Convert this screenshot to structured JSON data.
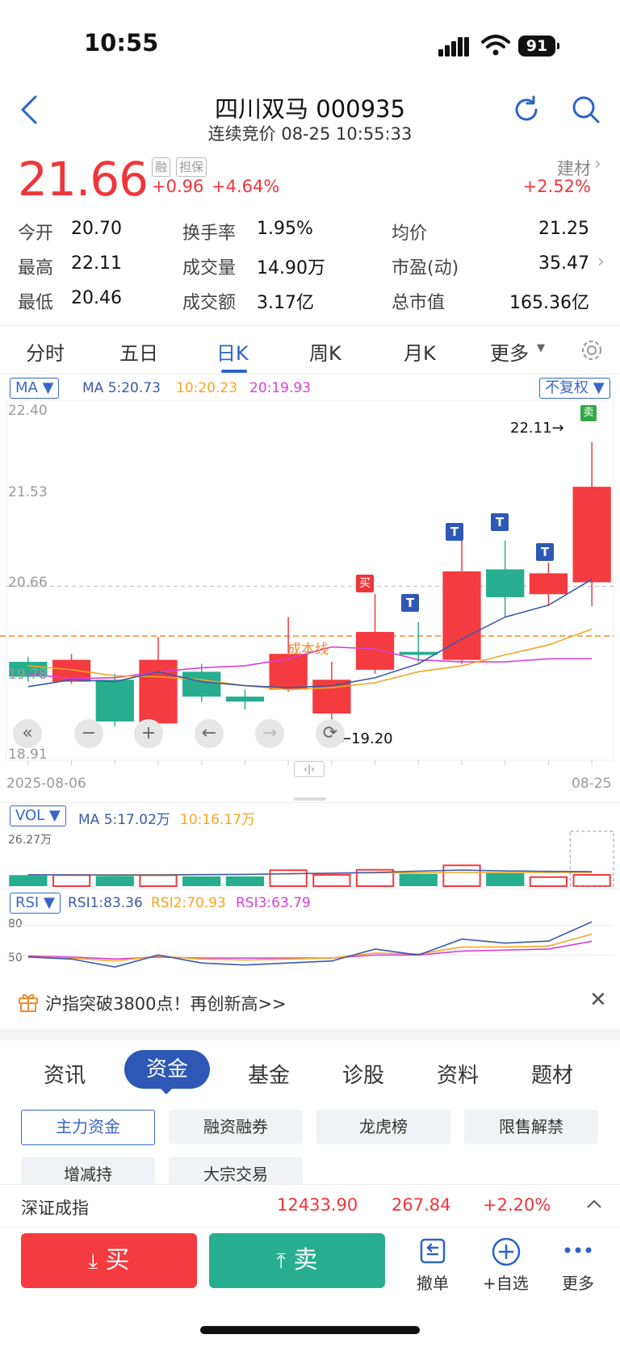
{
  "status_bar": {
    "time": "10:55",
    "battery": "91"
  },
  "header": {
    "title": "四川双马 000935",
    "subtitle": "连续竞价 08-25 10:55:33"
  },
  "quote": {
    "price": "21.66",
    "tags": [
      "融",
      "担保"
    ],
    "change": "+0.96",
    "change_pct": "+4.64%",
    "sector_name": "建材",
    "sector_pct": "+2.52%",
    "stats": [
      {
        "label": "今开",
        "value": "20.70",
        "color": "#111111"
      },
      {
        "label": "最高",
        "value": "22.11",
        "color": "#f0353a"
      },
      {
        "label": "最低",
        "value": "20.46",
        "color": "#20a98a"
      },
      {
        "label": "换手率",
        "value": "1.95%",
        "color": "#111111"
      },
      {
        "label": "成交量",
        "value": "14.90万",
        "color": "#111111"
      },
      {
        "label": "成交额",
        "value": "3.17亿",
        "color": "#111111"
      },
      {
        "label": "均价",
        "value": "21.25",
        "color": "#f0353a"
      },
      {
        "label": "市盈(动)",
        "value": "35.47",
        "color": "#111111"
      },
      {
        "label": "总市值",
        "value": "165.36亿",
        "color": "#111111"
      }
    ]
  },
  "chart_tabs": [
    {
      "label": "分时"
    },
    {
      "label": "五日"
    },
    {
      "label": "日K"
    },
    {
      "label": "周K"
    },
    {
      "label": "月K"
    },
    {
      "label": "更多"
    }
  ],
  "kline": {
    "indicator": "MA",
    "ma5": "MA 5:20.73",
    "ma10": "10:20.23",
    "ma20": "20:19.93",
    "adjust": "不复权",
    "y_ticks": [
      "22.40",
      "21.53",
      "20.66",
      "19.78",
      "18.91"
    ],
    "cost_line_label": "成本线",
    "high_marker": "22.11→",
    "low_marker": "←19.20",
    "date_start": "2025-08-06",
    "date_end": "08-25",
    "buy_mark": "买",
    "sell_mark": "卖",
    "t_mark": "T"
  },
  "chart_data": {
    "type": "candlestick",
    "candles": [
      {
        "o": 19.9,
        "c": 19.75,
        "h": 19.95,
        "l": 19.7
      },
      {
        "o": 19.7,
        "c": 19.92,
        "h": 19.98,
        "l": 19.68
      },
      {
        "o": 19.72,
        "c": 19.3,
        "h": 19.78,
        "l": 19.25
      },
      {
        "o": 19.28,
        "c": 19.92,
        "h": 20.15,
        "l": 19.25
      },
      {
        "o": 19.8,
        "c": 19.55,
        "h": 19.88,
        "l": 19.5
      },
      {
        "o": 19.55,
        "c": 19.5,
        "h": 19.62,
        "l": 19.42
      },
      {
        "o": 19.62,
        "c": 19.98,
        "h": 20.35,
        "l": 19.6
      },
      {
        "o": 19.38,
        "c": 19.72,
        "h": 19.9,
        "l": 19.2
      },
      {
        "o": 19.82,
        "c": 20.2,
        "h": 20.58,
        "l": 19.78
      },
      {
        "o": 20.0,
        "c": 19.97,
        "h": 20.3,
        "l": 19.9
      },
      {
        "o": 19.92,
        "c": 20.81,
        "h": 21.2,
        "l": 19.88
      },
      {
        "o": 20.83,
        "c": 20.55,
        "h": 21.12,
        "l": 20.35
      },
      {
        "o": 20.58,
        "c": 20.79,
        "h": 20.9,
        "l": 20.46
      },
      {
        "o": 20.7,
        "c": 21.66,
        "h": 22.11,
        "l": 20.46
      }
    ],
    "ma5": [
      19.65,
      19.72,
      19.7,
      19.8,
      19.7,
      19.66,
      19.64,
      19.66,
      19.74,
      19.88,
      20.13,
      20.35,
      20.47,
      20.73
    ],
    "ma10": [
      19.86,
      19.82,
      19.76,
      19.75,
      19.72,
      19.66,
      19.62,
      19.64,
      19.69,
      19.8,
      19.86,
      19.97,
      20.07,
      20.23
    ],
    "ma20": [
      19.78,
      19.73,
      19.74,
      19.8,
      19.84,
      19.86,
      19.93,
      20.05,
      20.03,
      19.92,
      19.9,
      19.9,
      19.93,
      19.93
    ],
    "cost_line": 20.16,
    "ylim": [
      18.91,
      22.4
    ],
    "volume": {
      "label": "VOL",
      "ma_text": "MA 5:17.02万",
      "ma10_text": "10:16.17万",
      "max_label": "26.27万",
      "values": [
        5,
        5,
        4.6,
        5,
        4.4,
        4.4,
        7.2,
        5.1,
        7.4,
        5.6,
        9.4,
        5.9,
        4.1,
        5.1
      ],
      "ylim": [
        0,
        26.27
      ],
      "ma5": [
        5.2,
        5.1,
        5.0,
        5.0,
        5.2,
        5.3,
        5.6,
        5.9,
        6.2,
        6.8,
        7.3,
        6.9,
        6.7,
        6.6
      ],
      "ma10": [
        5.0,
        5.1,
        5.1,
        5.2,
        5.3,
        5.4,
        5.6,
        5.8,
        6.0,
        6.1,
        6.2,
        6.2,
        6.2,
        6.2
      ]
    },
    "rsi": {
      "label": "RSI",
      "rsi1_text": "RSI1:83.36",
      "rsi2_text": "RSI2:70.93",
      "rsi3_text": "RSI3:63.79",
      "ticks": [
        "80",
        "50"
      ],
      "rsi1": [
        48,
        46,
        38,
        50,
        42,
        40,
        42,
        44,
        56,
        50,
        66,
        62,
        64,
        83.36
      ],
      "rsi2": [
        48,
        47,
        44,
        49,
        46,
        45,
        46,
        47,
        52,
        51,
        58,
        58,
        59,
        70.93
      ],
      "rsi3": [
        49,
        48,
        46,
        48,
        47,
        47,
        47,
        47,
        50,
        50,
        54,
        55,
        56,
        63.79
      ],
      "ylim": [
        30,
        90
      ]
    }
  },
  "banner": {
    "text": "沪指突破3800点！再创新高>>"
  },
  "section_tabs": [
    "资讯",
    "资金",
    "基金",
    "诊股",
    "资料",
    "题材"
  ],
  "sub_tabs": [
    "主力资金",
    "融资融券",
    "龙虎榜",
    "限售解禁",
    "增减持",
    "大宗交易"
  ],
  "index_bar": {
    "name": "深证成指",
    "value": "12433.90",
    "change": "267.84",
    "pct": "+2.20%"
  },
  "actions": {
    "buy": "买",
    "sell": "卖",
    "cancel": "撤单",
    "add_watch": "+自选",
    "more": "更多"
  }
}
